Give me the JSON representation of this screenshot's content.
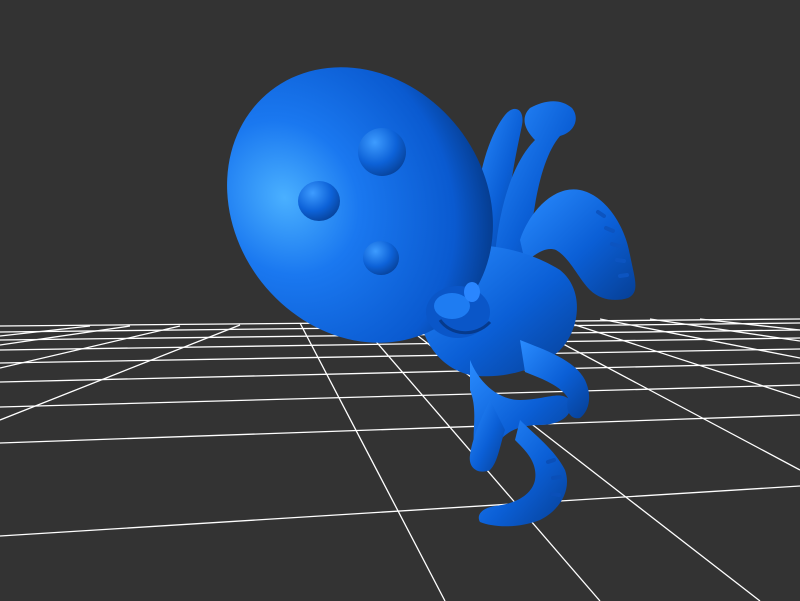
{
  "viewport": {
    "background_color": "#333333",
    "grid_color": "#ffffff",
    "model_color": "#0a5fd8",
    "model_highlight": "#3aa0ff",
    "model_shadow": "#063a8c",
    "model_subject": "octopus"
  }
}
